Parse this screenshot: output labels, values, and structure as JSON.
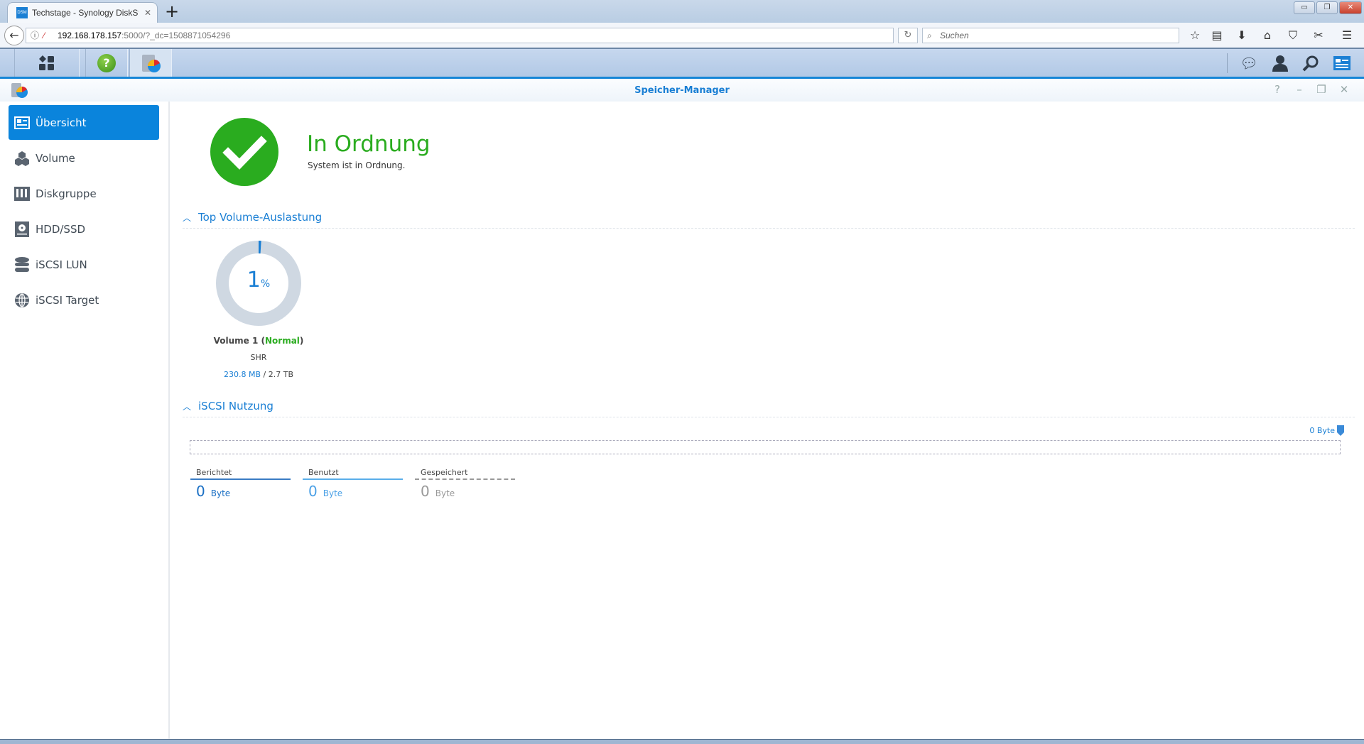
{
  "browser": {
    "tab_title": "Techstage - Synology DiskSta",
    "tab_favicon": "DSM",
    "url_host": "192.168.178.157",
    "url_rest": ":5000/?_dc=1508871054296",
    "search_placeholder": "Suchen"
  },
  "dsm": {
    "taskbar_icons": [
      "main-menu-icon",
      "help-icon",
      "storage-manager-icon"
    ],
    "right_icons": [
      "notifications-icon",
      "user-icon",
      "search-icon",
      "widgets-icon"
    ]
  },
  "window": {
    "title": "Speicher-Manager",
    "controls": {
      "help": "?",
      "minimize": "–",
      "maximize": "❐",
      "close": "✕"
    }
  },
  "sidebar": {
    "items": [
      {
        "label": "Übersicht",
        "icon": "overview-icon",
        "selected": true
      },
      {
        "label": "Volume",
        "icon": "volume-icon"
      },
      {
        "label": "Diskgruppe",
        "icon": "diskgroup-icon"
      },
      {
        "label": "HDD/SSD",
        "icon": "hdd-icon"
      },
      {
        "label": "iSCSI LUN",
        "icon": "lun-icon"
      },
      {
        "label": "iSCSI Target",
        "icon": "target-icon"
      }
    ]
  },
  "status": {
    "title": "In Ordnung",
    "subtitle": "System ist in Ordnung.",
    "color": "#2aac1f"
  },
  "volume_section": {
    "title": "Top Volume-Auslastung",
    "volumes": [
      {
        "percent": "1",
        "percent_sign": "%",
        "percent_value": 1,
        "name": "Volume 1",
        "state": "Normal",
        "type": "SHR",
        "used": "230.8 MB",
        "separator": " / ",
        "total": "2.7 TB"
      }
    ]
  },
  "iscsi_section": {
    "title": "iSCSI Nutzung",
    "scale_label": "0 Byte",
    "stats": [
      {
        "label": "Berichtet",
        "value": "0",
        "unit": "Byte"
      },
      {
        "label": "Benutzt",
        "value": "0",
        "unit": "Byte"
      },
      {
        "label": "Gespeichert",
        "value": "0",
        "unit": "Byte"
      }
    ]
  }
}
